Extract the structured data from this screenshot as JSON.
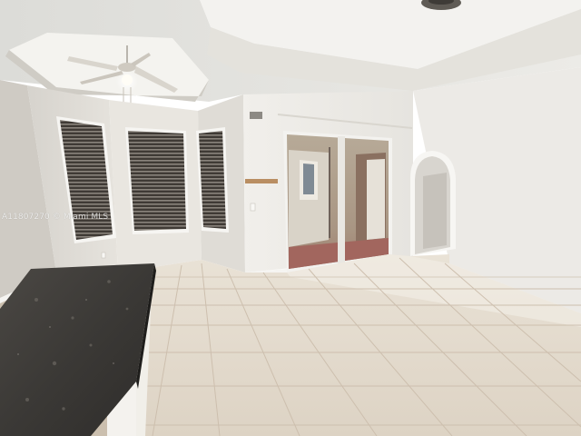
{
  "photo": {
    "watermark": "A11807270 © Miami MLS"
  }
}
